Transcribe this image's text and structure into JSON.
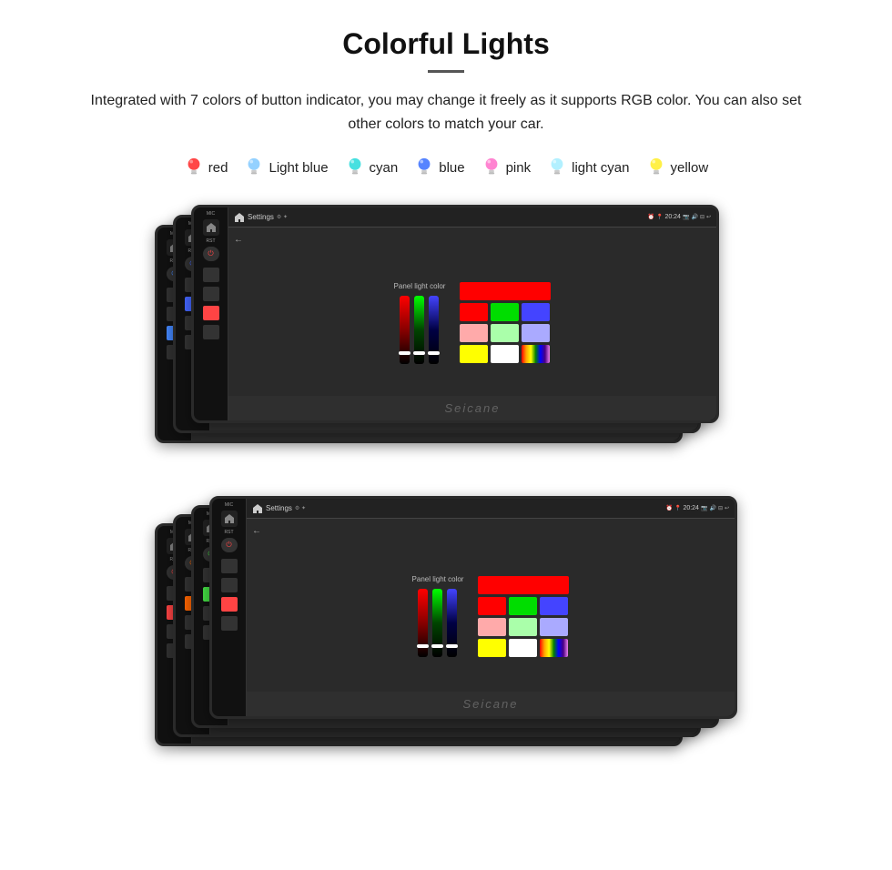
{
  "title": "Colorful Lights",
  "description": "Integrated with 7 colors of button indicator, you may change it freely as it supports RGB color. You can also set other colors to match your car.",
  "colors": [
    {
      "name": "red",
      "hex": "#ff3333"
    },
    {
      "name": "Light blue",
      "hex": "#88ccff"
    },
    {
      "name": "cyan",
      "hex": "#33dddd"
    },
    {
      "name": "blue",
      "hex": "#4477ff"
    },
    {
      "name": "pink",
      "hex": "#ff77cc"
    },
    {
      "name": "light cyan",
      "hex": "#aaeeff"
    },
    {
      "name": "yellow",
      "hex": "#ffee33"
    }
  ],
  "device": {
    "settings_label": "Settings",
    "time": "20:24",
    "back_label": "←",
    "panel_light_label": "Panel light color",
    "watermark": "Seicane"
  },
  "color_grid": {
    "top_wide": "#ff0000",
    "row2": [
      "#ff0000",
      "#00dd00",
      "#4444ff"
    ],
    "row3": [
      "#ffaaaa",
      "#aaffaa",
      "#aaaaff"
    ],
    "row4": [
      "#ffff00",
      "#ffffff",
      "rainbow"
    ]
  }
}
